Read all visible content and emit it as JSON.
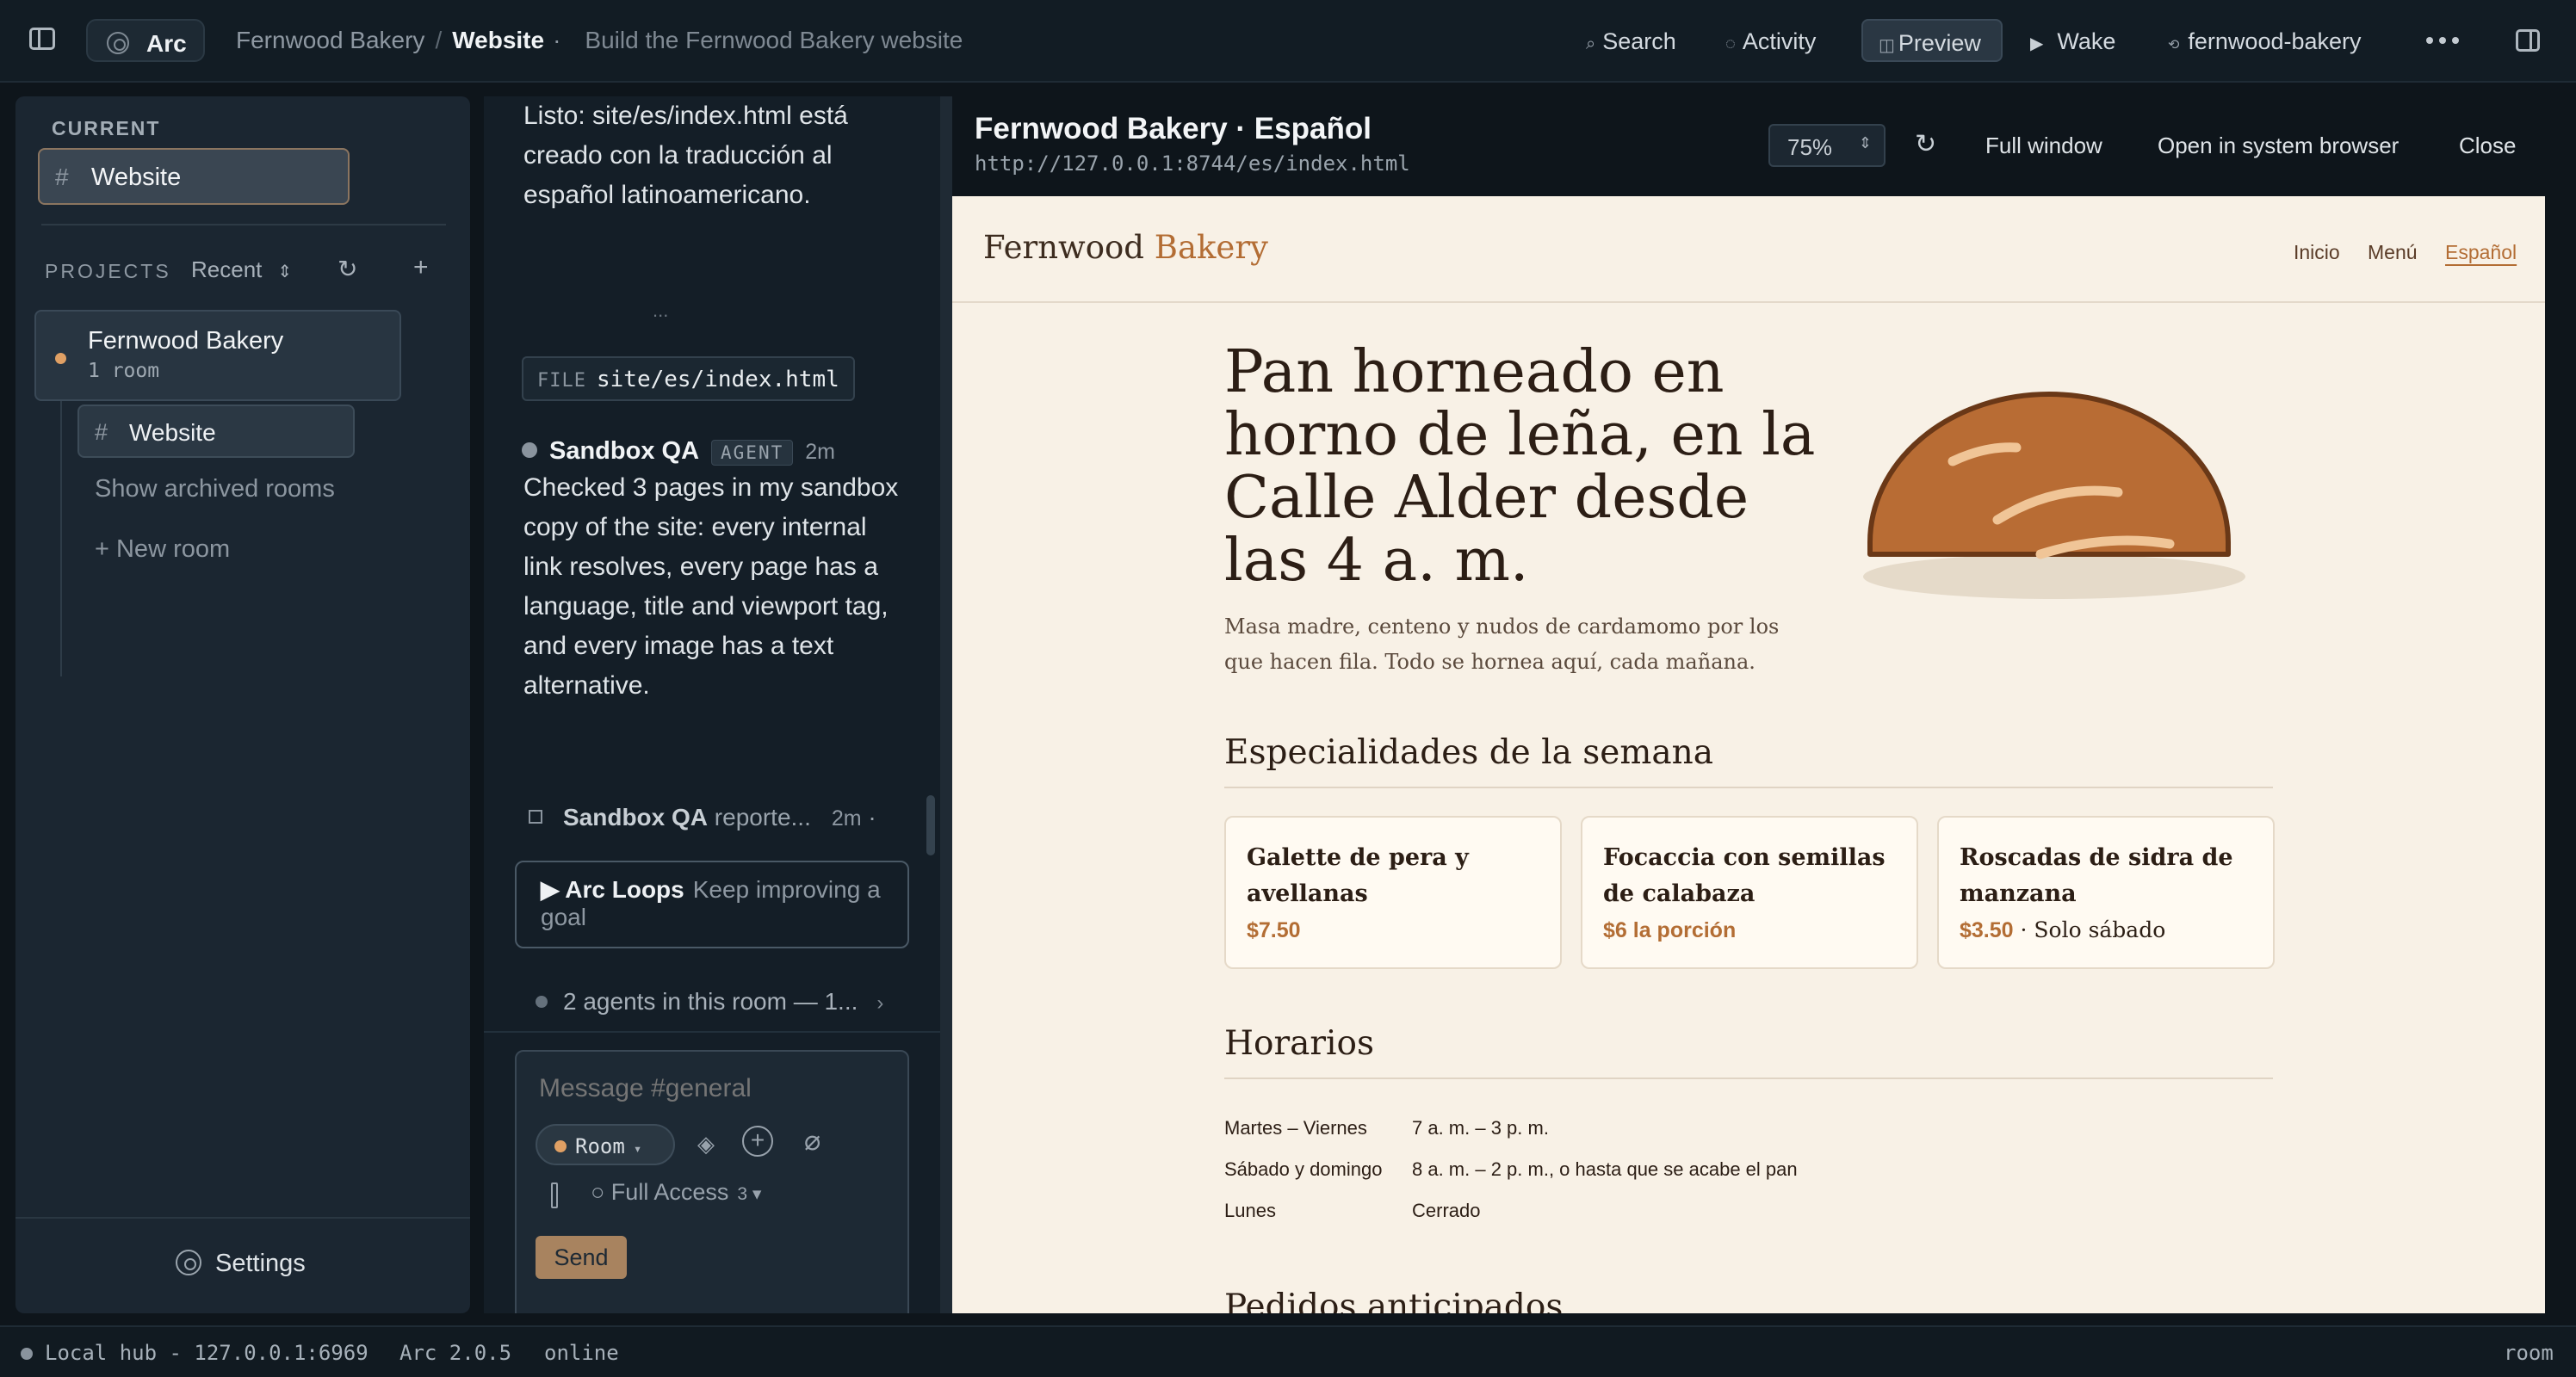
{
  "topbar": {
    "app_name": "Arc",
    "project": "Fernwood Bakery",
    "separator": "/",
    "room": "Website",
    "room_dot": "·",
    "room_desc": "Build the Fernwood Bakery website",
    "search_icon": "⌕",
    "search_label": "Search",
    "activity_icon": "◌",
    "activity_label": "Activity",
    "preview_icon": "◫",
    "preview_label": "Preview",
    "wake_icon": "▶",
    "wake_label": "Wake",
    "branch_icon": "⟲",
    "branch_label": "fernwood-bakery"
  },
  "sidebar": {
    "current_label": "CURRENT",
    "current_room": "Website",
    "projects_label": "PROJECTS",
    "sort_value": "Recent",
    "project": {
      "name": "Fernwood Bakery",
      "meta": "1 room"
    },
    "room": "Website",
    "archived_link": "Show archived rooms",
    "new_room_link": "+ New room",
    "settings_label": "Settings"
  },
  "chat": {
    "msg1": "Listo: site/es/index.html está creado con la traducción al español latinoamericano.",
    "ellipsis": "...",
    "file_chip": {
      "kind": "FILE",
      "path": "site/es/index.html"
    },
    "qa_message": {
      "author": "Sandbox QA",
      "badge": "AGENT",
      "time": "2m",
      "text": "Checked 3 pages in my sandbox copy of the site: every internal link resolves, every page has a language, title and viewport tag, and every image has a text alternative."
    },
    "report_line": {
      "author": "Sandbox QA",
      "text": "reporte...",
      "time": "2m",
      "dot": "·"
    },
    "loops_card": {
      "title": "▶ Arc Loops",
      "text": "Keep improving a goal"
    },
    "agents_line": "2 agents in this room — 1...",
    "composer": {
      "placeholder": "Message #general",
      "room_chip": "Room",
      "access_label": "○ Full Access",
      "access_count": "3 ▾",
      "send_label": "Send"
    }
  },
  "preview": {
    "title": "Fernwood Bakery · Español",
    "url": "http://127.0.0.1:8744/es/index.html",
    "zoom": "75%",
    "full_window": "Full window",
    "open_browser": "Open in system browser",
    "close": "Close"
  },
  "site": {
    "logo_main": "Fernwood",
    "logo_accent": "Bakery",
    "nav": [
      "Inicio",
      "Menú",
      "Español"
    ],
    "hero_title": "Pan horneado en horno de leña, en la Calle Alder desde las 4 a. m.",
    "hero_sub": "Masa madre, centeno y nudos de cardamomo por los que hacen fila. Todo se hornea aquí, cada mañana.",
    "specials_heading": "Especialidades de la semana",
    "specials": [
      {
        "name": "Galette de pera y avellanas",
        "price": "$7.50",
        "note": ""
      },
      {
        "name": "Focaccia con semillas de calabaza",
        "price": "$6 la porción",
        "note": ""
      },
      {
        "name": "Roscadas de sidra de manzana",
        "price": "$3.50",
        "note": " · Solo sábado"
      }
    ],
    "hours_heading": "Horarios",
    "hours": [
      {
        "days": "Martes – Viernes",
        "time": "7 a. m. – 3 p. m."
      },
      {
        "days": "Sábado y domingo",
        "time": "8 a. m. – 2 p. m., o hasta que se acabe el pan"
      },
      {
        "days": "Lunes",
        "time": "Cerrado"
      }
    ],
    "preorder_heading": "Pedidos anticipados"
  },
  "statusbar": {
    "hub": "Local hub - 127.0.0.1:6969",
    "version": "Arc 2.0.5",
    "state": "online",
    "scope": "room"
  },
  "colors": {
    "app_bg": "#0e151b",
    "accent_orange": "#e0a064",
    "site_bg": "#f8f1e6",
    "site_accent": "#b36d34",
    "send_button": "#a8835f"
  }
}
